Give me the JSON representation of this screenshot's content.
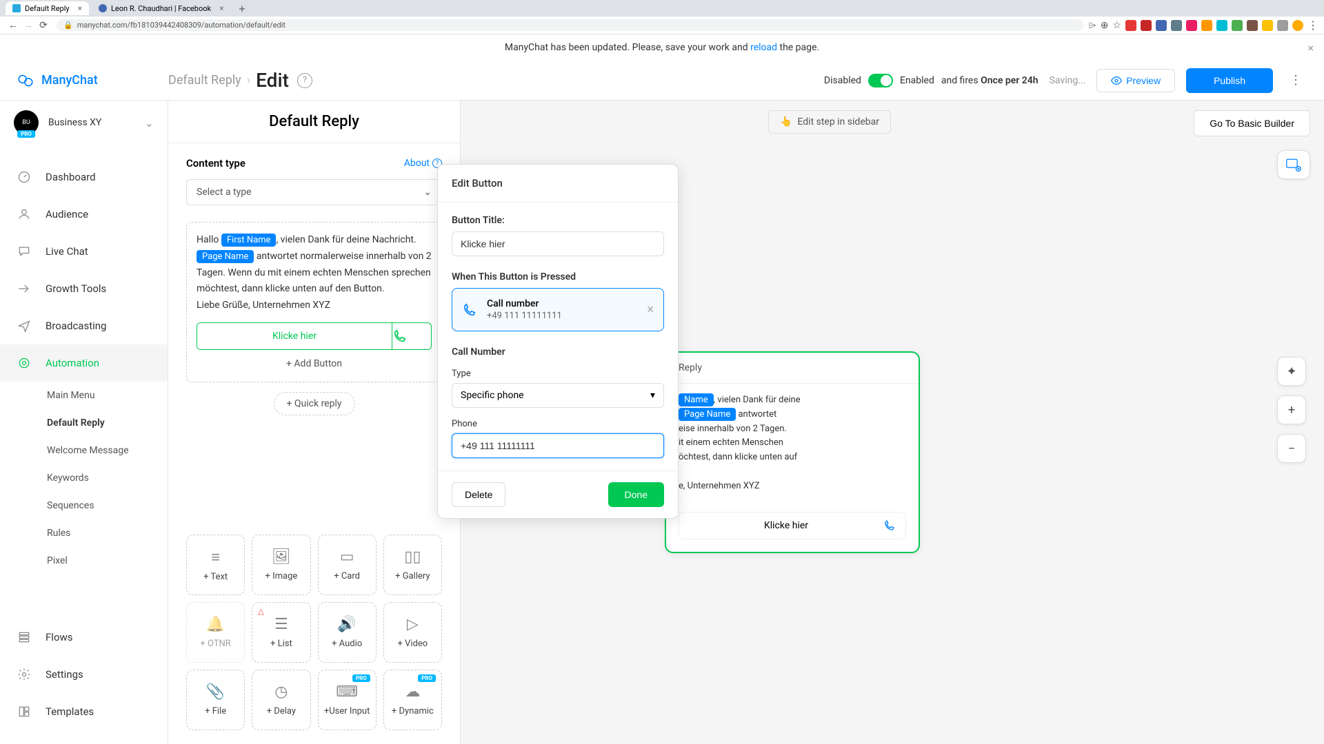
{
  "browser": {
    "tabs": [
      {
        "title": "Default Reply",
        "active": true
      },
      {
        "title": "Leon R. Chaudhari | Facebook",
        "active": false
      }
    ],
    "url": "manychat.com/fb181039442408309/automation/default/edit"
  },
  "banner": {
    "prefix": "ManyChat has been updated. Please, save your work and ",
    "link": "reload",
    "suffix": " the page."
  },
  "header": {
    "logo": "ManyChat",
    "breadcrumb": "Default Reply",
    "current": "Edit",
    "disabled_label": "Disabled",
    "enabled_label": "Enabled",
    "fires_prefix": "and fires ",
    "fires_bold": "Once per 24h",
    "saving": "Saving...",
    "preview": "Preview",
    "publish": "Publish"
  },
  "sidebar": {
    "org": "Business XY",
    "pro": "PRO",
    "items": {
      "dashboard": "Dashboard",
      "audience": "Audience",
      "live_chat": "Live Chat",
      "growth": "Growth Tools",
      "broadcasting": "Broadcasting",
      "automation": "Automation",
      "flows": "Flows",
      "settings": "Settings",
      "templates": "Templates"
    },
    "sub": {
      "main_menu": "Main Menu",
      "default_reply": "Default Reply",
      "welcome": "Welcome Message",
      "keywords": "Keywords",
      "sequences": "Sequences",
      "rules": "Rules",
      "pixel": "Pixel"
    }
  },
  "panel": {
    "title": "Default Reply",
    "content_type": "Content type",
    "about": "About",
    "select_type": "Select a type",
    "msg": {
      "t1": "Hallo ",
      "var1": "First Name",
      "t2": ", vielen Dank für deine Nachricht. ",
      "var2": "Page Name",
      "t3": " antwortet normalerweise innerhalb von 2 Tagen. Wenn du mit einem echten Menschen sprechen möchtest, dann klicke unten auf den Button.",
      "t4": "Liebe Grüße, Unternehmen XYZ"
    },
    "button_label": "Klicke hier",
    "add_button": "+ Add Button",
    "quick_reply": "+ Quick reply",
    "blocks": {
      "text": "+ Text",
      "image": "+ Image",
      "card": "+ Card",
      "gallery": "+ Gallery",
      "otnr": "+ OTNR",
      "list": "+ List",
      "audio": "+ Audio",
      "video": "+ Video",
      "file": "+ File",
      "delay": "+ Delay",
      "user_input": "+User Input",
      "dynamic": "+ Dynamic"
    }
  },
  "popover": {
    "title": "Edit Button",
    "button_title_label": "Button Title:",
    "button_title_value": "Klicke hier",
    "when_pressed": "When This Button is Pressed",
    "action": {
      "title": "Call number",
      "sub": "+49 111 11111111"
    },
    "call_number_label": "Call Number",
    "type_label": "Type",
    "type_value": "Specific phone",
    "phone_label": "Phone",
    "phone_value": "+49 111 11111111",
    "delete": "Delete",
    "done": "Done"
  },
  "canvas": {
    "edit_step": "Edit step in sidebar",
    "node_title": "Reply",
    "node_t1a": "Name",
    "node_t1b": ", vielen Dank für deine ",
    "node_t2a": "Page Name",
    "node_t2b": " antwortet",
    "node_t3": "eise innerhalb von 2 Tagen.",
    "node_t4": "it einem echten Menschen",
    "node_t5": "öchtest, dann klicke unten auf",
    "node_t6": "e, Unternehmen XYZ",
    "node_btn": "Klicke hier",
    "go_basic": "Go To Basic Builder"
  }
}
